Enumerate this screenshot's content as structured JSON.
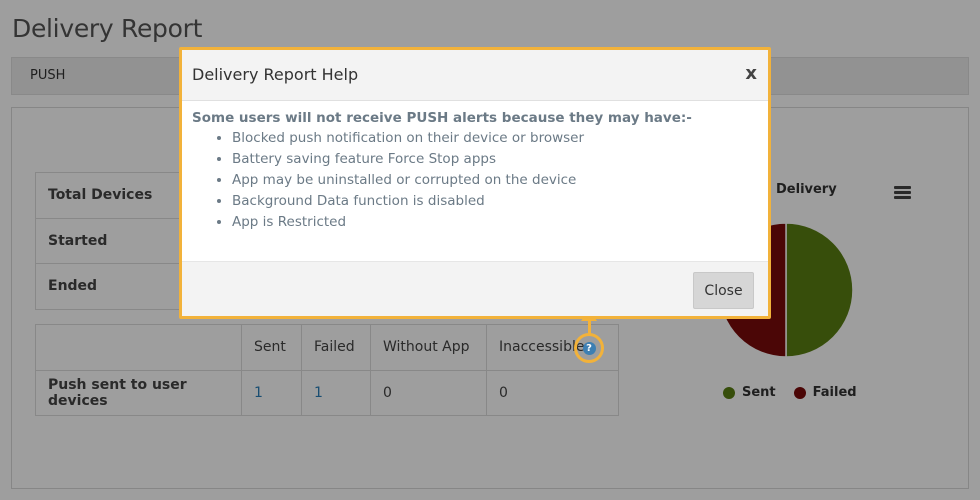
{
  "page": {
    "title": "Delivery Report",
    "tab": "PUSH"
  },
  "summary": {
    "rows": [
      {
        "label": "Total Devices"
      },
      {
        "label": "Started"
      },
      {
        "label": "Ended"
      }
    ]
  },
  "push_table": {
    "headers": [
      "",
      "Sent",
      "Failed",
      "Without App",
      "Inaccessible"
    ],
    "row": {
      "label": "Push sent to user devices",
      "sent": "1",
      "failed": "1",
      "without_app": "0",
      "inaccessible": "0"
    },
    "help_icon": "question-icon"
  },
  "chart_data": {
    "type": "pie",
    "title": "Delivery",
    "categories": [
      "Sent",
      "Failed"
    ],
    "values": [
      1,
      1
    ],
    "colors": [
      "#5a7f12",
      "#7a0b0b"
    ],
    "legend_position": "bottom"
  },
  "modal": {
    "title": "Delivery Report Help",
    "close_x": "x",
    "lead": "Some users will not receive PUSH alerts because they may have:-",
    "items": [
      "Blocked push notification on their device or browser",
      "Battery saving feature Force Stop apps",
      "App may be uninstalled or corrupted on the device",
      "Background Data function is disabled",
      "App is Restricted"
    ],
    "close_button": "Close"
  },
  "colors": {
    "highlight": "#f2b23a",
    "link": "#2a7fb8",
    "sent": "#5a7f12",
    "failed": "#7a0b0b"
  }
}
